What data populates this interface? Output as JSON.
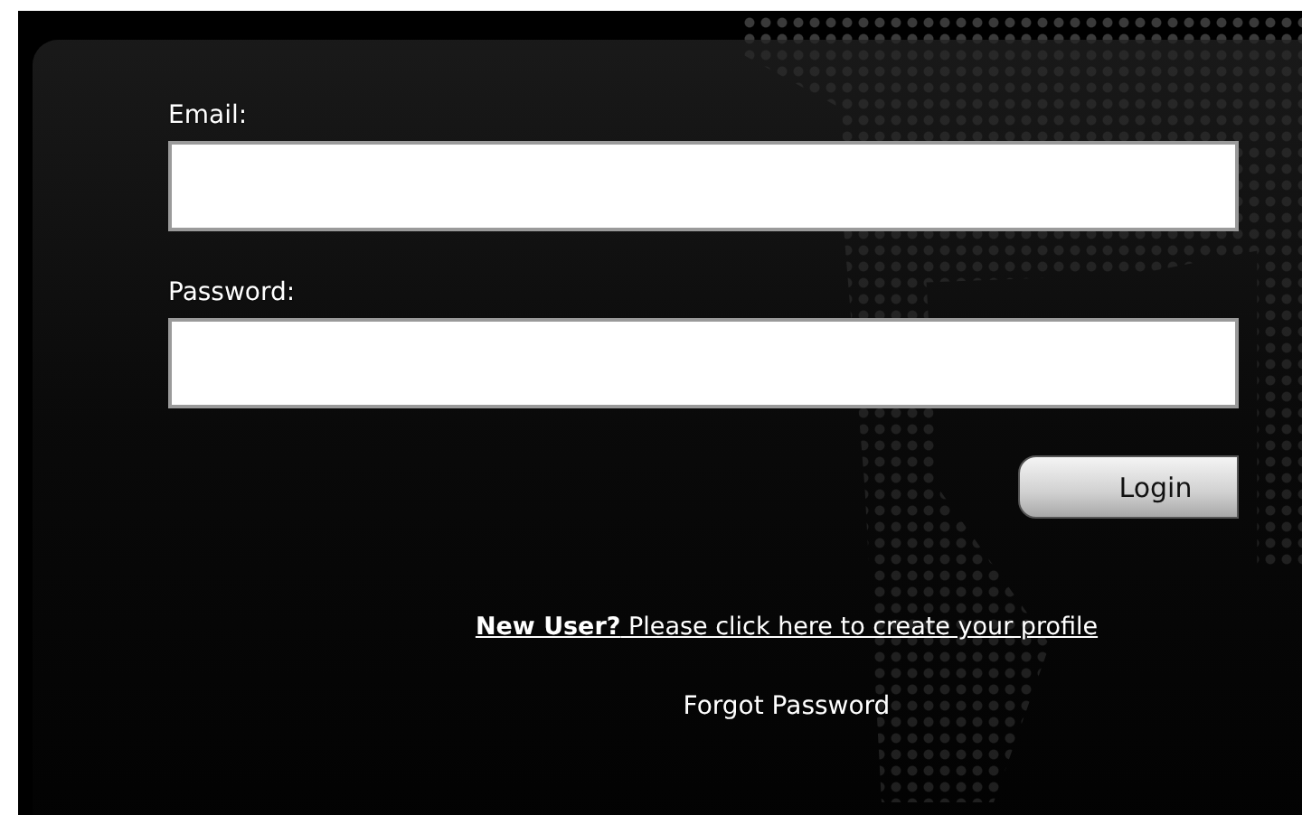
{
  "form": {
    "fields": [
      {
        "label": "Email:"
      },
      {
        "label": "Password:"
      }
    ],
    "login_button": "Login",
    "signup_link": "**New User?** Please click here to create your profile",
    "forgot_link": "Forgot Password"
  }
}
